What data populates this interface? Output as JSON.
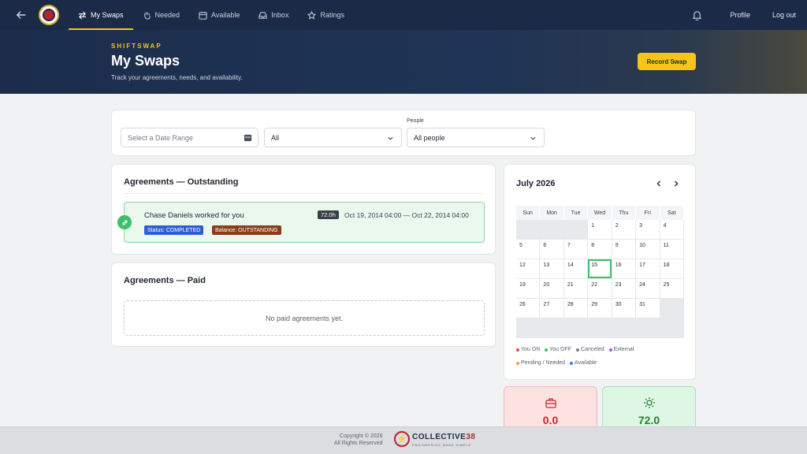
{
  "nav": {
    "links": [
      {
        "label": "My Swaps",
        "icon": "swap-icon"
      },
      {
        "label": "Needed",
        "icon": "hand-icon"
      },
      {
        "label": "Available",
        "icon": "calendar-icon"
      },
      {
        "label": "Inbox",
        "icon": "inbox-icon"
      },
      {
        "label": "Ratings",
        "icon": "star-icon"
      }
    ],
    "profile": "Profile",
    "logout": "Log out"
  },
  "hero": {
    "eyebrow": "SHIFTSWAP",
    "title": "My Swaps",
    "subtitle": "Track your agreements, needs, and availability.",
    "record_button": "Record Swap"
  },
  "filters": {
    "date_placeholder": "Select a Date Range",
    "status_value": "All",
    "people_label": "People",
    "people_value": "All people"
  },
  "outstanding": {
    "title": "Agreements — Outstanding",
    "items": [
      {
        "title": "Chase Daniels worked for you",
        "hours": "72.0h",
        "range": "Oct 19, 2014 04:00 — Oct 22, 2014 04:00",
        "status": "Status: COMPLETED",
        "balance": "Balance: OUTSTANDING"
      }
    ]
  },
  "paid": {
    "title": "Agreements — Paid",
    "empty_text": "No paid agreements yet."
  },
  "calendar": {
    "month": "July 2026",
    "weekdays": [
      "Sun",
      "Mon",
      "Tue",
      "Wed",
      "Thu",
      "Fri",
      "Sat"
    ],
    "leading_blanks": 3,
    "days_in_month": 31,
    "today": 15,
    "legend": [
      {
        "label": "You ON",
        "color": "#e04848"
      },
      {
        "label": "You OFF",
        "color": "#3cc06a"
      },
      {
        "label": "Canceled",
        "color": "#7a7f88"
      },
      {
        "label": "External",
        "color": "#a259e6"
      },
      {
        "label": "Pending / Needed",
        "color": "#f0a030"
      },
      {
        "label": "Available",
        "color": "#3c7be0"
      }
    ]
  },
  "stats": {
    "on_value": "0.0",
    "on_color": "#c62828",
    "off_value": "72.0",
    "off_color": "#2e7d32"
  },
  "footer": {
    "copyright_line1": "Copyright © 2026",
    "copyright_line2": "All Rights Reserved",
    "brand": "COLLECTIVE",
    "brand_num": "38",
    "tagline": "ENGINEERING MADE SIMPLE"
  }
}
